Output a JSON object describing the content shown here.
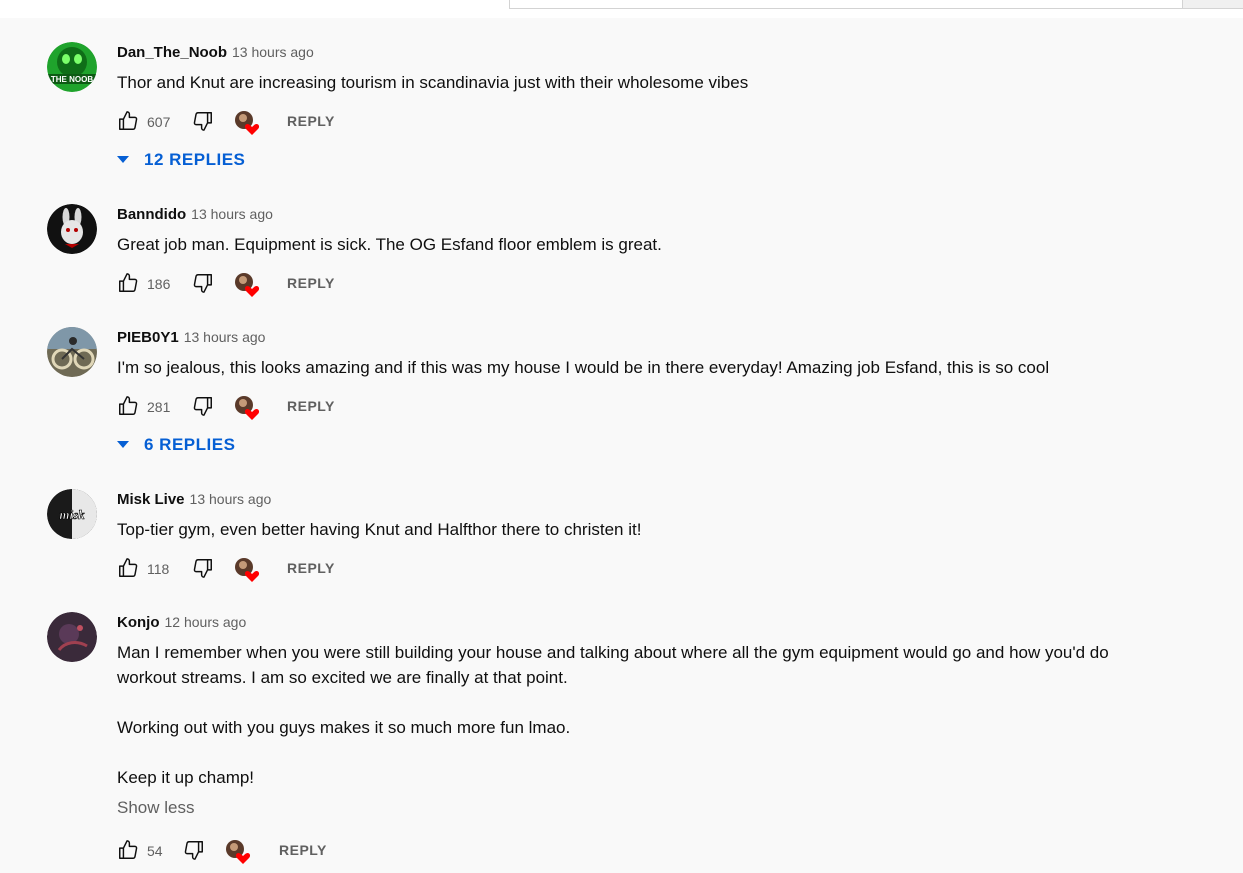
{
  "comments": [
    {
      "author": "Dan_The_Noob",
      "time": "13 hours ago",
      "text": "Thor and Knut are increasing tourism in scandinavia just with their wholesome vibes",
      "likes": "607",
      "reply_label": "REPLY",
      "replies_label": "12 REPLIES",
      "avatar_text": "THE NOOB"
    },
    {
      "author": "Banndido",
      "time": "13 hours ago",
      "text": "Great job man. Equipment is sick. The OG Esfand floor emblem is great.",
      "likes": "186",
      "reply_label": "REPLY"
    },
    {
      "author": "PIEB0Y1",
      "time": "13 hours ago",
      "text": "I'm so jealous, this looks amazing and if this was my house I would be in there everyday! Amazing job Esfand, this is so cool",
      "likes": "281",
      "reply_label": "REPLY",
      "replies_label": "6 REPLIES"
    },
    {
      "author": "Misk Live",
      "time": "13 hours ago",
      "text": "Top-tier gym, even better having Knut and Halfthor there to christen it!",
      "likes": "118",
      "reply_label": "REPLY",
      "avatar_text": "misk"
    },
    {
      "author": "Konjo",
      "time": "12 hours ago",
      "text": "Man I remember when you were still building your house and talking about where all the gym equipment would go and how you'd do\nworkout streams. I am so excited we are finally at that point.\n\nWorking out with you guys makes it so much more fun lmao.\n\nKeep it up champ!",
      "show_less_label": "Show less",
      "likes": "54",
      "reply_label": "REPLY"
    }
  ],
  "colors": {
    "background": "#f9f9f9",
    "link_blue": "#065fd4",
    "heart_red": "#ff0000",
    "secondary_text": "#606060"
  }
}
